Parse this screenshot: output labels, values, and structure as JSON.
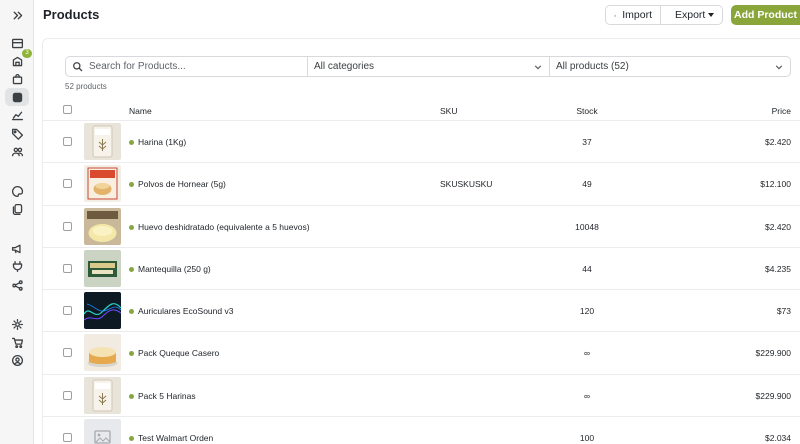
{
  "header": {
    "title": "Products",
    "import_label": "Import",
    "export_label": "Export",
    "add_label": "Add Product"
  },
  "sidebar": {
    "badge_count": "3",
    "items": [
      {
        "icon": "expand-icon"
      },
      {
        "icon": "store-icon"
      },
      {
        "icon": "orders-icon"
      },
      {
        "icon": "bag-icon"
      },
      {
        "icon": "products-icon"
      },
      {
        "icon": "analytics-icon"
      },
      {
        "icon": "tag-icon"
      },
      {
        "icon": "customers-icon"
      },
      {
        "icon": "palette-icon"
      },
      {
        "icon": "pages-icon"
      },
      {
        "icon": "megaphone-icon"
      },
      {
        "icon": "plug-icon"
      },
      {
        "icon": "share-icon"
      },
      {
        "icon": "settings-icon"
      },
      {
        "icon": "cart-icon"
      },
      {
        "icon": "account-icon"
      }
    ]
  },
  "filters": {
    "search_placeholder": "Search for Products...",
    "category": "All categories",
    "product_filter": "All products (52)"
  },
  "count_label": "52 products",
  "table": {
    "columns": {
      "name": "Name",
      "sku": "SKU",
      "stock": "Stock",
      "price": "Price"
    },
    "rows": [
      {
        "name": "Harina (1Kg)",
        "sku": "",
        "stock": "37",
        "price": "$2.420",
        "thumb": "flour"
      },
      {
        "name": "Polvos de Hornear (5g)",
        "sku": "SKUSKUSKU",
        "stock": "49",
        "price": "$12.100",
        "thumb": "powder"
      },
      {
        "name": "Huevo deshidratado (equivalente a 5 huevos)",
        "sku": "",
        "stock": "10048",
        "price": "$2.420",
        "thumb": "egg"
      },
      {
        "name": "Mantequilla (250 g)",
        "sku": "",
        "stock": "44",
        "price": "$4.235",
        "thumb": "butter"
      },
      {
        "name": "Auriculares EcoSound v3",
        "sku": "",
        "stock": "120",
        "price": "$73",
        "thumb": "headphones"
      },
      {
        "name": "Pack Queque Casero",
        "sku": "",
        "stock": "∞",
        "price": "$229.900",
        "thumb": "cake"
      },
      {
        "name": "Pack 5 Harinas",
        "sku": "",
        "stock": "∞",
        "price": "$229.900",
        "thumb": "flour"
      },
      {
        "name": "Test Walmart Orden",
        "sku": "",
        "stock": "100",
        "price": "$2.034",
        "thumb": "placeholder"
      }
    ]
  },
  "colors": {
    "accent": "#8aa63a",
    "status_active": "#86a640"
  }
}
